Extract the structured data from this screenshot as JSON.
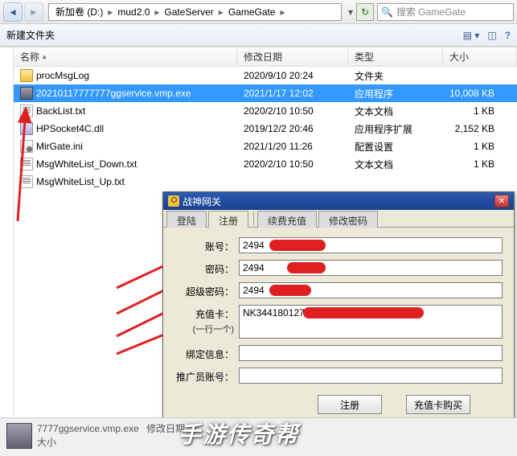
{
  "toolbar": {
    "breadcrumb": [
      "新加卷 (D:)",
      "mud2.0",
      "GateServer",
      "GameGate"
    ],
    "search_placeholder": "搜索 GameGate"
  },
  "cmdbar": {
    "new_folder": "新建文件夹"
  },
  "columns": {
    "name": "名称",
    "date": "修改日期",
    "type": "类型",
    "size": "大小"
  },
  "files": [
    {
      "icon": "folder",
      "name": "procMsgLog",
      "date": "2020/9/10 20:24",
      "type": "文件夹",
      "size": "",
      "selected": false
    },
    {
      "icon": "exe",
      "name": "20210117777777ggservice.vmp.exe",
      "date": "2021/1/17 12:02",
      "type": "应用程序",
      "size": "10,008 KB",
      "selected": true
    },
    {
      "icon": "txt",
      "name": "BackList.txt",
      "date": "2020/2/10 10:50",
      "type": "文本文档",
      "size": "1 KB",
      "selected": false
    },
    {
      "icon": "dll",
      "name": "HPSocket4C.dll",
      "date": "2019/12/2 20:46",
      "type": "应用程序扩展",
      "size": "2,152 KB",
      "selected": false
    },
    {
      "icon": "ini",
      "name": "MirGate.ini",
      "date": "2021/1/20 11:26",
      "type": "配置设置",
      "size": "1 KB",
      "selected": false
    },
    {
      "icon": "txt",
      "name": "MsgWhiteList_Down.txt",
      "date": "2020/2/10 10:50",
      "type": "文本文档",
      "size": "1 KB",
      "selected": false
    },
    {
      "icon": "txt",
      "name": "MsgWhiteList_Up.txt",
      "date": "",
      "type": "",
      "size": "",
      "selected": false
    }
  ],
  "dialog": {
    "title": "战神网关",
    "tabs": [
      "登陆",
      "注册",
      "续费充值",
      "修改密码"
    ],
    "active_tab": 1,
    "labels": {
      "account": "账号：",
      "password": "密码：",
      "super_password": "超级密码：",
      "recharge_card": "充值卡：",
      "card_hint": "(一行一个)",
      "bind_info": "绑定信息：",
      "promoter": "推广员账号："
    },
    "values": {
      "account": "2494",
      "password": "2494",
      "super_password": "2494",
      "recharge_card": "NK344180127",
      "bind_info": "",
      "promoter": ""
    },
    "buttons": {
      "register": "注册",
      "buy_card": "充值卡购买"
    }
  },
  "statusbar": {
    "filename": "7777ggservice.vmp.exe",
    "date_label": "修改日期",
    "size_label": "大小"
  },
  "watermark": "手游传奇帮"
}
